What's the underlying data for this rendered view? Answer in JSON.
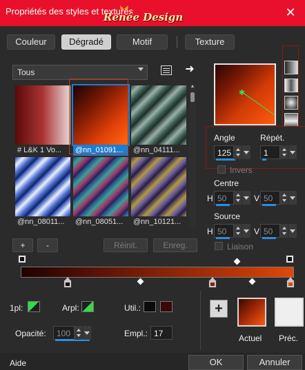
{
  "window": {
    "title": "Propriétés des styles et textures",
    "watermark": "Renée Design",
    "close": "✕"
  },
  "tabs": [
    {
      "label": "Couleur",
      "active": false
    },
    {
      "label": "Dégradé",
      "active": true
    },
    {
      "label": "Motif",
      "active": false
    },
    {
      "label": "Texture",
      "active": false
    }
  ],
  "category": {
    "value": "Tous"
  },
  "thumbnails": [
    {
      "caption": "# L&K 1 Vo...",
      "gradient": "linear-gradient(90deg,#5a0a0a,#a33,#e8d8d8)",
      "selected": false
    },
    {
      "caption": "@nn_01091...",
      "gradient": "linear-gradient(135deg,#1a0200 0%,#7a1a04 35%,#e04008 70%,#ff6a10 100%)",
      "selected": true
    },
    {
      "caption": "@nn_04111...",
      "gradient": "repeating-linear-gradient(135deg,#2b3f3a 0px,#9ab0a8 8px,#3a5a50 16px,#1a2a24 22px)",
      "selected": false
    },
    {
      "caption": "@nn_08011...",
      "gradient": "repeating-linear-gradient(135deg,#1a3fa8 0px,#e8eefc 9px,#5a7ad8 16px,#0a1a60 24px)",
      "selected": false
    },
    {
      "caption": "@nn_08051...",
      "gradient": "repeating-linear-gradient(135deg,#2a3a8a 0px,#3aa090 8px,#a03a70 15px,#1a2050 22px)",
      "selected": false
    },
    {
      "caption": "@nn_10121...",
      "gradient": "repeating-linear-gradient(135deg,#3a2a60 0px,#b09a40 8px,#6a5aa0 15px,#201830 22px)",
      "selected": false
    }
  ],
  "buttons": {
    "add": "+",
    "remove": "-",
    "reinit": "Réinit.",
    "save": "Enreg."
  },
  "angle": {
    "label": "Angle",
    "value": "125"
  },
  "repeat": {
    "label": "Répét.",
    "value": "1"
  },
  "inverse": {
    "label": "Invers",
    "checked": false
  },
  "center": {
    "label": "Centre",
    "h_label": "H",
    "h_value": "50",
    "v_label": "V",
    "v_value": "50"
  },
  "source": {
    "label": "Source",
    "h_label": "H",
    "h_value": "50",
    "v_label": "V",
    "v_value": "50"
  },
  "link": {
    "label": "Liaison",
    "checked": false
  },
  "stops": {
    "first_label": "1pl:",
    "first_color": "#35d94a",
    "arpl_label": "Arpl:",
    "arpl_color": "#35d94a",
    "util_label": "Util.:",
    "util_colors": [
      "#0a0a0a",
      "#3a0808"
    ],
    "opacity_label": "Opacité:",
    "opacity_value": "100",
    "location_label": "Empl.:",
    "location_value": "17"
  },
  "swatches": {
    "current_label": "Actuel",
    "previous_label": "Préc."
  },
  "footer": {
    "help": "Aide",
    "ok": "OK",
    "cancel": "Annuler"
  }
}
